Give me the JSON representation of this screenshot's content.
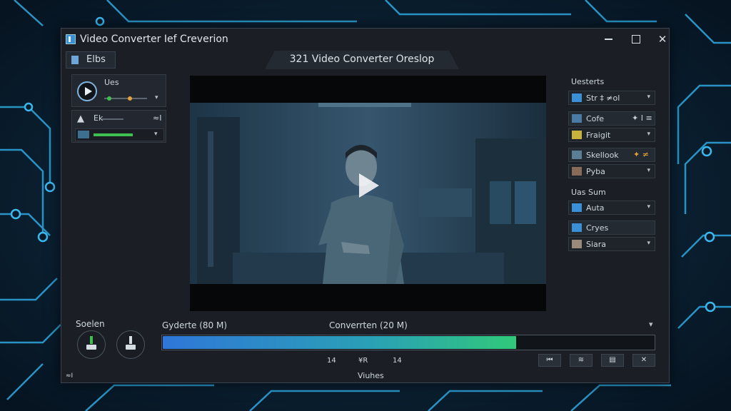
{
  "window": {
    "title": "Video Converter Ief Creverion",
    "controls": {
      "minimize": "minimize",
      "maximize": "maximize",
      "close": "✕"
    }
  },
  "tabs": {
    "files_label": "Elbs",
    "center_label": "321 Video Converter Oreslop"
  },
  "left_panel": {
    "label": "Ues",
    "row2_label": "Ek",
    "row2_suffix": "≈I"
  },
  "right_panel": {
    "section1_title": "Uesterts",
    "rows": [
      {
        "label": "Str ‡ ≠ol",
        "icon": "film-icon"
      },
      {
        "label": "Cofe",
        "icon": "video-icon",
        "extra": "✦ I ≡"
      },
      {
        "label": "Fraigit",
        "icon": "image-icon"
      },
      {
        "label": "Skellook",
        "icon": "clip-icon",
        "extra": "✦ ≠"
      },
      {
        "label": "Pyba",
        "icon": "photo-icon"
      }
    ],
    "section2_title": "Uas Sum",
    "rows2": [
      {
        "label": "Auta",
        "icon": "audio-icon"
      },
      {
        "label": "Cryes",
        "icon": "video-icon"
      },
      {
        "label": "Siara",
        "icon": "portrait-icon"
      }
    ]
  },
  "bottom": {
    "section_label": "Soelen",
    "left_status": "Gyderte (80 M)",
    "center_status": "Converrten (20 M)",
    "progress_fraction": 0.72,
    "time_marks": [
      "14",
      "¥R",
      "14"
    ],
    "footer_label": "Viuhes",
    "corner_label": "≈I",
    "tool_buttons": [
      "⏮",
      "≋",
      "▤",
      "✕"
    ]
  },
  "colors": {
    "accent": "#3b8fd6",
    "progress_start": "#2f77d8",
    "progress_end": "#31c97a",
    "slider_green": "#3fbf4f",
    "slider_orange": "#e3a33a"
  }
}
